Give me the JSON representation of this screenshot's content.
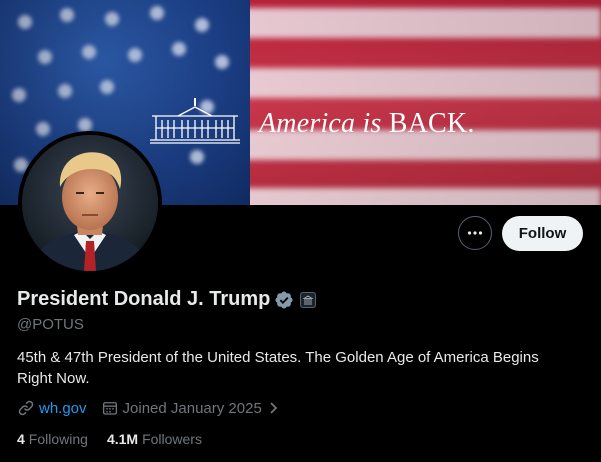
{
  "banner": {
    "tagline_italic": "America is ",
    "tagline_bold": "BACK."
  },
  "profile": {
    "name": "President Donald J. Trump",
    "handle": "@POTUS",
    "bio": "45th & 47th President of the United States. The Golden Age of America Begins Right Now.",
    "website": "wh.gov",
    "joined": "Joined January 2025",
    "following_count": "4",
    "following_label": "Following",
    "followers_count": "4.1M",
    "followers_label": "Followers"
  },
  "actions": {
    "follow_label": "Follow",
    "more_icon": "more-dots-icon"
  },
  "colors": {
    "background": "#000000",
    "link": "#1d9bf0",
    "verified_badge": "#829aab",
    "follow_button_bg": "#eff3f4"
  }
}
